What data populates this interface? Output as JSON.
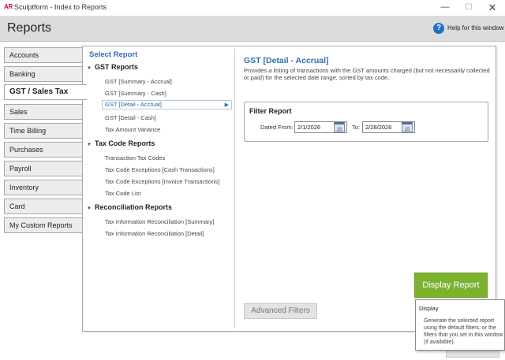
{
  "window": {
    "app_icon": "AR",
    "title": "Sculptform - Index to Reports",
    "minimize_glyph": "—",
    "maximize_glyph": "☐",
    "close_glyph": "✕"
  },
  "header": {
    "title": "Reports",
    "help_icon": "?",
    "help_label": "Help for this window"
  },
  "tabs": [
    {
      "label": "Accounts"
    },
    {
      "label": "Banking"
    },
    {
      "label": "GST / Sales Tax",
      "active": true
    },
    {
      "label": "Sales"
    },
    {
      "label": "Time Billing"
    },
    {
      "label": "Purchases"
    },
    {
      "label": "Payroll"
    },
    {
      "label": "Inventory"
    },
    {
      "label": "Card"
    },
    {
      "label": "My Custom Reports"
    }
  ],
  "report_list": {
    "heading": "Select Report",
    "groups": [
      {
        "title": "GST Reports",
        "items": [
          {
            "label": "GST [Summary - Accrual]"
          },
          {
            "label": "GST [Summary - Cash]"
          },
          {
            "label": "GST [Detail - Accrual]",
            "selected": true
          },
          {
            "label": "GST [Detail - Cash]"
          },
          {
            "label": "Tax Amount Variance"
          }
        ]
      },
      {
        "title": "Tax Code Reports",
        "items": [
          {
            "label": "Transaction Tax Codes"
          },
          {
            "label": "Tax Code Exceptions [Cash Transactions]"
          },
          {
            "label": "Tax Code Exceptions [Invoice Transactions]"
          },
          {
            "label": "Tax Code List"
          }
        ]
      },
      {
        "title": "Reconciliation Reports",
        "items": [
          {
            "label": "Tax Information Reconciliation [Summary]"
          },
          {
            "label": "Tax Information Reconciliation [Detail]"
          }
        ]
      }
    ]
  },
  "detail": {
    "title": "GST [Detail - Accrual]",
    "description": "Provides a listing of transactions with the GST amounts charged (but not necessarily collected or paid) for the selected date range, sorted by tax code."
  },
  "filter": {
    "title": "Filter Report",
    "dated_from_label": "Dated From:",
    "dated_from_value": "2/1/2026",
    "to_label": "To:",
    "to_value": "2/28/2026",
    "calendar_glyph": "15"
  },
  "buttons": {
    "advanced_filters": "Advanced Filters",
    "display_report": "Display Report"
  },
  "tooltip": {
    "title": "Display",
    "body": "Generate the selected report using the default filters, or the filters that you set in this window (if available)."
  },
  "colors": {
    "accent_blue": "#2e6eb5",
    "display_green": "#7bb32e",
    "help_blue": "#1e6fc8"
  }
}
